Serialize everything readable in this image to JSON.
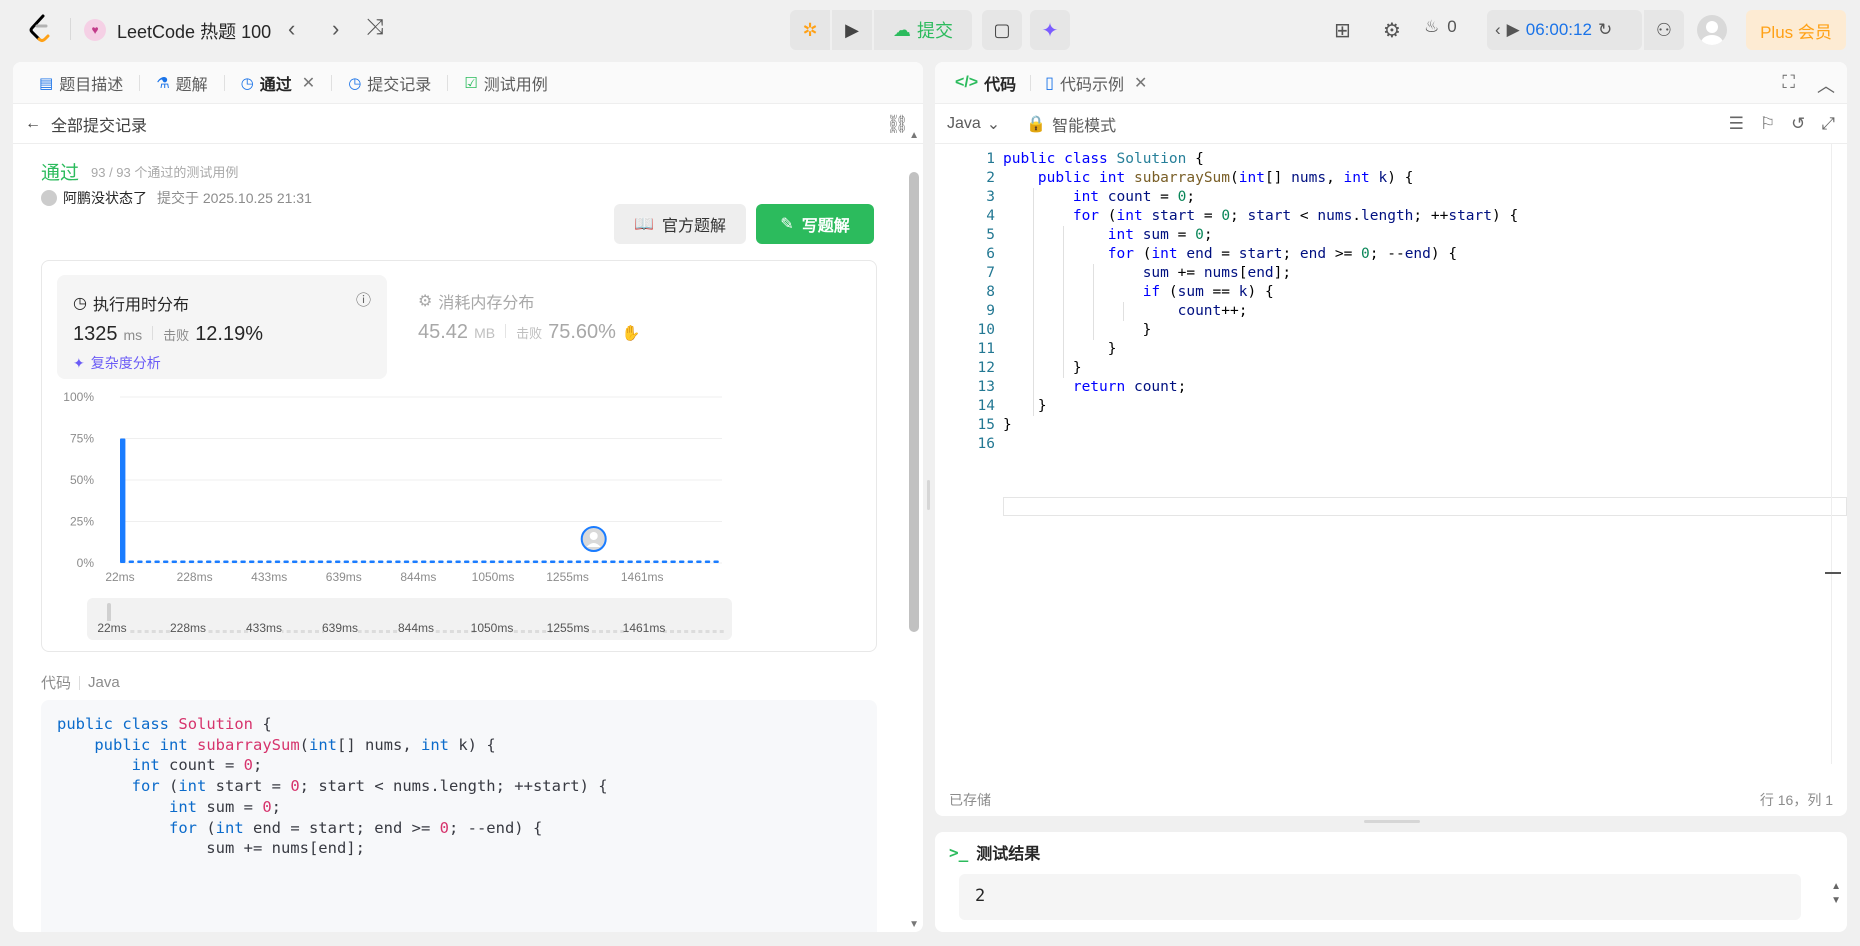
{
  "topbar": {
    "list_title": "LeetCode 热题 100",
    "submit_label": "提交",
    "streak_count": "0",
    "timer": "06:00:12",
    "plus_label": "Plus 会员"
  },
  "left_tabs": [
    {
      "label": "题目描述"
    },
    {
      "label": "题解"
    },
    {
      "label": "通过"
    },
    {
      "label": "提交记录"
    },
    {
      "label": "测试用例"
    }
  ],
  "back_label": "全部提交记录",
  "result": {
    "status": "通过",
    "count": "93 / 93 个通过的测试用例",
    "author": "阿鹏没状态了",
    "submitted": "提交于 2025.10.25 21:31",
    "official_label": "官方题解",
    "write_label": "写题解"
  },
  "stats": {
    "time_title": "执行用时分布",
    "time_value": "1325",
    "time_unit": "ms",
    "beat_label": "击败",
    "time_beat": "12.19%",
    "complexity_label": "复杂度分析",
    "mem_title": "消耗内存分布",
    "mem_value": "45.42",
    "mem_unit": "MB",
    "mem_beat": "75.60%"
  },
  "chart_data": {
    "type": "bar",
    "yticks": [
      "100%",
      "75%",
      "50%",
      "25%",
      "0%"
    ],
    "ylim": [
      0,
      100
    ],
    "xticks": [
      "22ms",
      "228ms",
      "433ms",
      "639ms",
      "844ms",
      "1050ms",
      "1255ms",
      "1461ms"
    ],
    "bars_first": 75,
    "bar_count": 70,
    "bar_baseline": 1.5,
    "user_position_ms": "1325",
    "grid": true
  },
  "code_section": {
    "label": "代码",
    "lang": "Java"
  },
  "code_lines": [
    "public class Solution {",
    "    public int subarraySum(int[] nums, int k) {",
    "        int count = 0;",
    "        for (int start = 0; start < nums.length; ++start) {",
    "            int sum = 0;",
    "            for (int end = start; end >= 0; --end) {",
    "                sum += nums[end];",
    "                if (sum == k) {",
    "                    count++;",
    "                }",
    "            }",
    "        }",
    "        return count;",
    "    }",
    "}",
    ""
  ],
  "editor": {
    "tab_code": "代码",
    "tab_example": "代码示例",
    "lang": "Java",
    "mode": "智能模式",
    "saved": "已存储",
    "position": "行 16，列 1"
  },
  "test_result": {
    "title": "测试结果",
    "output": "2"
  },
  "colors": {
    "accent_green": "#2cbb5d",
    "bar_blue": "#1a7cff",
    "plus_orange": "#ffa116"
  }
}
